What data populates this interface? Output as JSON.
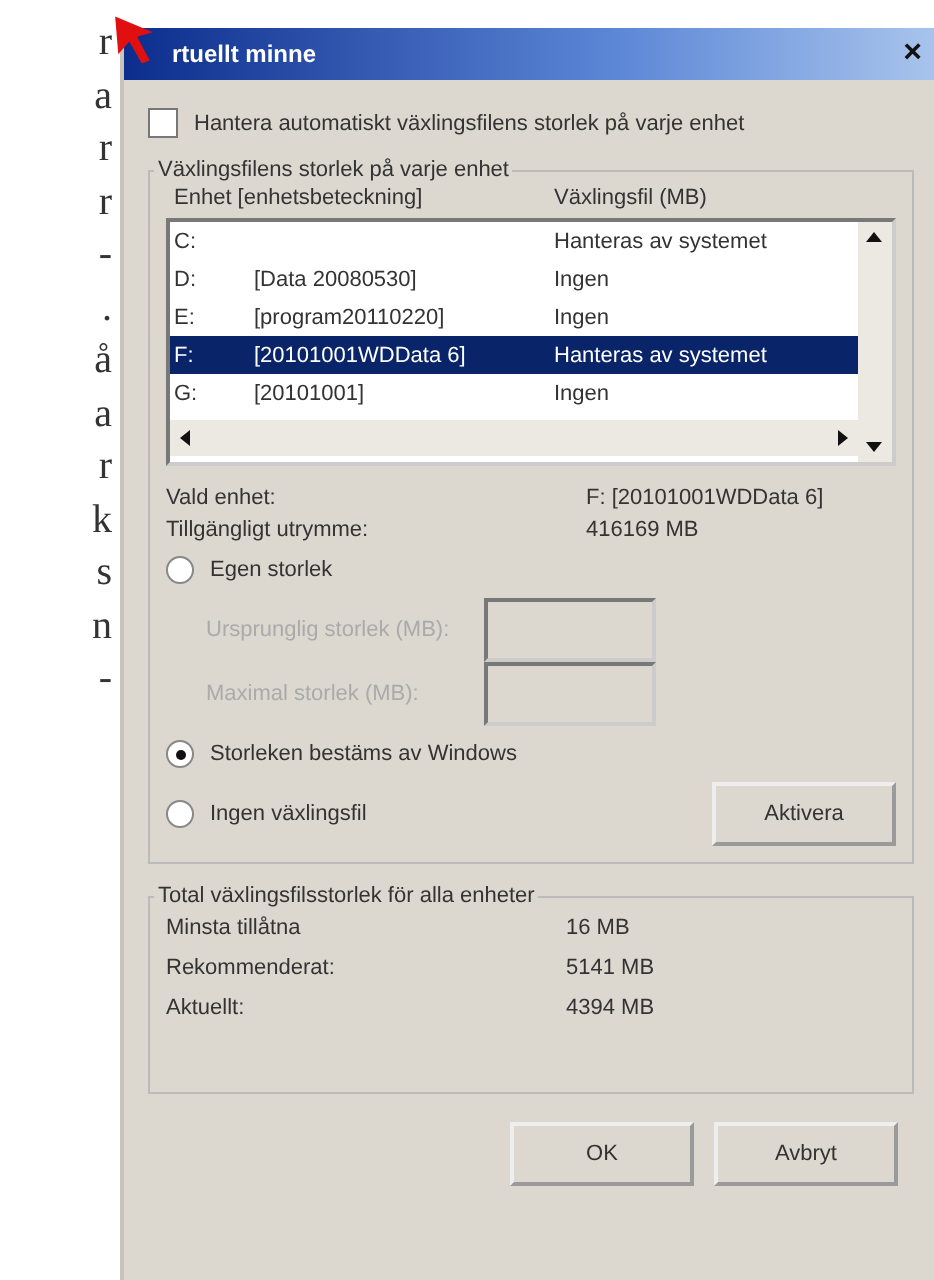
{
  "page_fragments": [
    "r",
    "a",
    "r",
    "r",
    "-",
    ".",
    "å",
    "a",
    "r",
    "k",
    "s",
    "n",
    "-"
  ],
  "window": {
    "title": "rtuellt minne",
    "close": "×"
  },
  "auto_manage": {
    "label": "Hantera automatiskt växlingsfilens storlek på varje enhet",
    "checked": false
  },
  "drives_group": {
    "title": "Växlingsfilens storlek på varje enhet",
    "columns": [
      "Enhet [enhetsbeteckning]",
      "Växlingsfil (MB)"
    ],
    "rows": [
      {
        "drive": "C:",
        "label": "",
        "pagefile": "Hanteras av systemet",
        "selected": false
      },
      {
        "drive": "D:",
        "label": "[Data 20080530]",
        "pagefile": "Ingen",
        "selected": false
      },
      {
        "drive": "E:",
        "label": "[program20110220]",
        "pagefile": "Ingen",
        "selected": false
      },
      {
        "drive": "F:",
        "label": "[20101001WDData 6]",
        "pagefile": "Hanteras av systemet",
        "selected": true
      },
      {
        "drive": "G:",
        "label": "[20101001]",
        "pagefile": "Ingen",
        "selected": false
      }
    ],
    "selected_drive_label": "Vald enhet:",
    "selected_drive_value": "F:  [20101001WDData 6]",
    "free_space_label": "Tillgängligt utrymme:",
    "free_space_value": "416169 MB",
    "options": [
      {
        "kind": "radio",
        "label": "Egen storlek",
        "selected": false
      },
      {
        "kind": "field",
        "label": "Ursprunglig storlek (MB):",
        "disabled": true
      },
      {
        "kind": "field",
        "label": "Maximal storlek (MB):",
        "disabled": true
      },
      {
        "kind": "radio",
        "label": "Storleken bestäms av Windows",
        "selected": true
      },
      {
        "kind": "radio",
        "label": "Ingen växlingsfil",
        "selected": false,
        "button": "Aktivera"
      }
    ]
  },
  "totals_group": {
    "title": "Total växlingsfilsstorlek för alla enheter",
    "rows": [
      {
        "label": "Minsta tillåtna",
        "value": "16 MB"
      },
      {
        "label": "Rekommenderat:",
        "value": "5141 MB"
      },
      {
        "label": "Aktuellt:",
        "value": "4394 MB"
      }
    ]
  },
  "buttons": [
    "OK",
    "Avbryt"
  ]
}
